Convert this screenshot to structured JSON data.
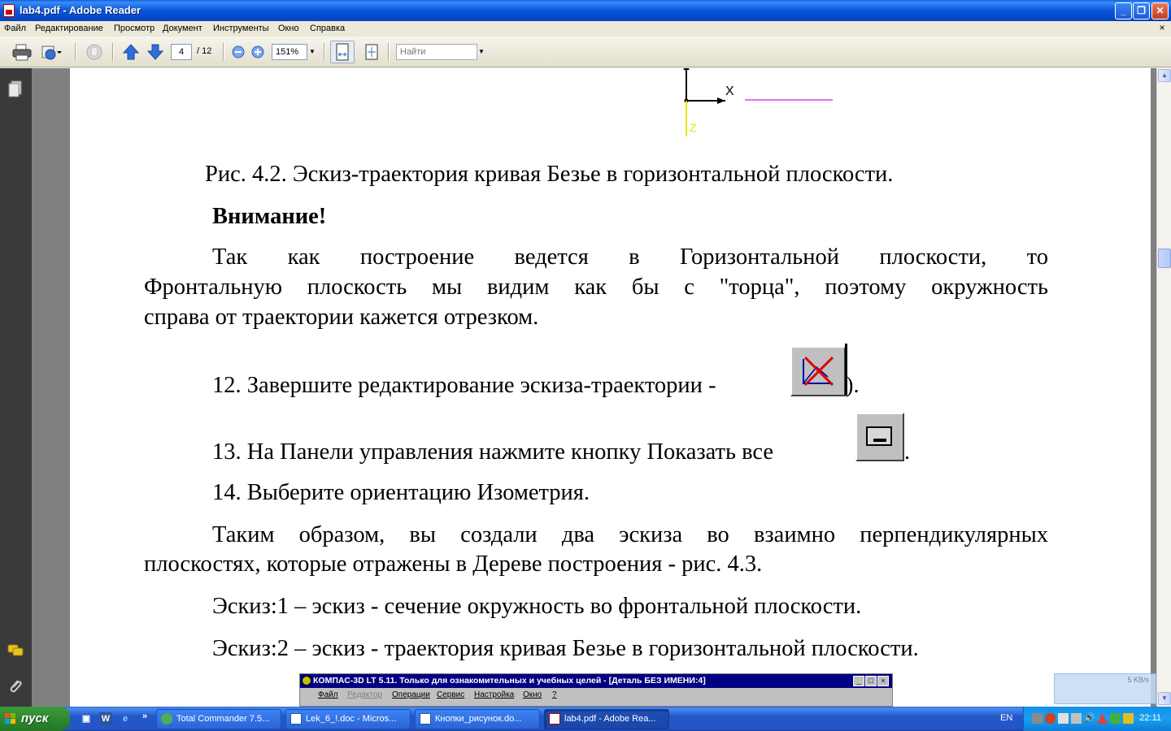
{
  "window": {
    "title": "lab4.pdf - Adobe Reader",
    "controls": {
      "minimize": "_",
      "maximize": "❐",
      "close": "✕"
    }
  },
  "menu": {
    "items": [
      "Файл",
      "Редактирование",
      "Просмотр",
      "Документ",
      "Инструменты",
      "Окно",
      "Справка"
    ],
    "close_doc": "×"
  },
  "toolbar": {
    "page_current": "4",
    "page_total": "/ 12",
    "zoom": "151%",
    "search_placeholder": "Найти"
  },
  "document": {
    "axis_x_label": "X",
    "axis_z_label": "Z",
    "caption": "Рис. 4.2. Эскиз-траектория кривая Безье в горизонтальной плоскости.",
    "attention": "Внимание!",
    "para1_line1": "Так как построение ведется в Горизонтальной плоскости, то",
    "para1_line2": "Фронтальную плоскость мы видим как бы с \"торца\", поэтому окружность",
    "para1_line3": "справа от траектории кажется отрезком.",
    "step12": "12. Завершите редактирование эскиза-траектории -",
    "step12_tail": ").",
    "step13": "13. На Панели управления нажмите кнопку Показать все",
    "step13_tail": ".",
    "step14": "14. Выберите ориентацию Изометрия.",
    "para2_line1": "Таким образом, вы создали два эскиза во взаимно перпендикулярных",
    "para2_line2": "плоскостях, которые отражены в Дереве построения - рис. 4.3.",
    "sketch1": "Эскиз:1 – эскиз - сечение окружность во фронтальной плоскости.",
    "sketch2": "Эскиз:2 – эскиз - траектория кривая Безье в горизонтальной плоскости.",
    "embedded": {
      "title": "КОМПАС-3D LT 5.11. Только для ознакомительных и учебных целей - [Деталь БЕЗ ИМЕНИ:4]",
      "menu": [
        "Файл",
        "Редактор",
        "Операции",
        "Сервис",
        "Настройка",
        "Окно",
        "?"
      ]
    }
  },
  "network_popup": {
    "rate": "5 KB/s"
  },
  "taskbar": {
    "start": "пуск",
    "more": "»",
    "tasks": [
      "Total Commander 7.5...",
      "Lek_6_!.doc - Micros...",
      "Кнопки_рисунок.do...",
      "lab4.pdf - Adobe Rea..."
    ],
    "lang": "EN",
    "clock": "22:11"
  },
  "colors": {
    "titlebar": "#0a5ee6",
    "taskbar": "#2456c8",
    "start": "#2f8a2f",
    "navpane": "#3a3a3a",
    "magenta_line": "#e040e0",
    "z_axis": "#e6e600"
  }
}
